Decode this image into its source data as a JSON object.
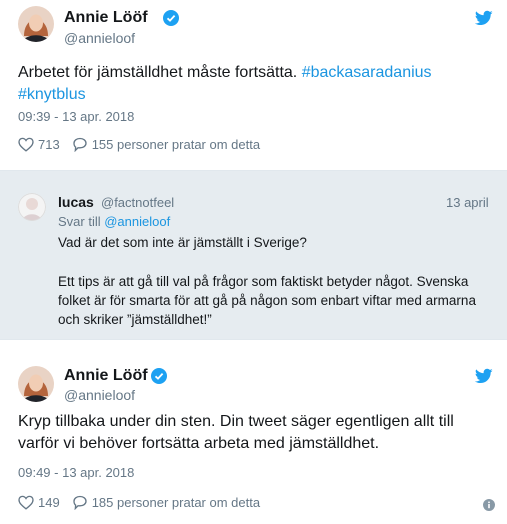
{
  "tweet1": {
    "author_name": "Annie Lööf",
    "author_handle": "@annieloof",
    "text_plain": "Arbetet för jämställdhet måste fortsätta. ",
    "hashtag1": "#backasaradanius",
    "hashtag2": "#knytblus",
    "timestamp": "09:39 - 13 apr. 2018",
    "likes": "713",
    "talking": "155 personer pratar om detta"
  },
  "reply": {
    "author_name": "lucas",
    "author_handle": "@factnotfeel",
    "date": "13 april",
    "reply_to_label": "Svar till ",
    "reply_to_handle": "@annieloof",
    "line1": "Vad är det som inte är jämställt i Sverige?",
    "line2": "Ett tips är att gå till val på frågor som faktiskt betyder något. Svenska folket är för smarta för att gå på någon som enbart viftar med armarna och skriker ”jämställdhet!”"
  },
  "tweet2": {
    "author_name": "Annie Lööf",
    "author_handle": "@annieloof",
    "text": "Kryp tillbaka under din sten. Din tweet säger egentligen allt till varför vi behöver fortsätta arbeta med jämställdhet.",
    "timestamp": "09:49 - 13 apr. 2018",
    "likes": "149",
    "talking": "185 personer pratar om detta"
  },
  "colors": {
    "accent": "#1da1f2",
    "link": "#1b95e0",
    "muted": "#657786",
    "reply_bg": "#e6ecf0"
  }
}
